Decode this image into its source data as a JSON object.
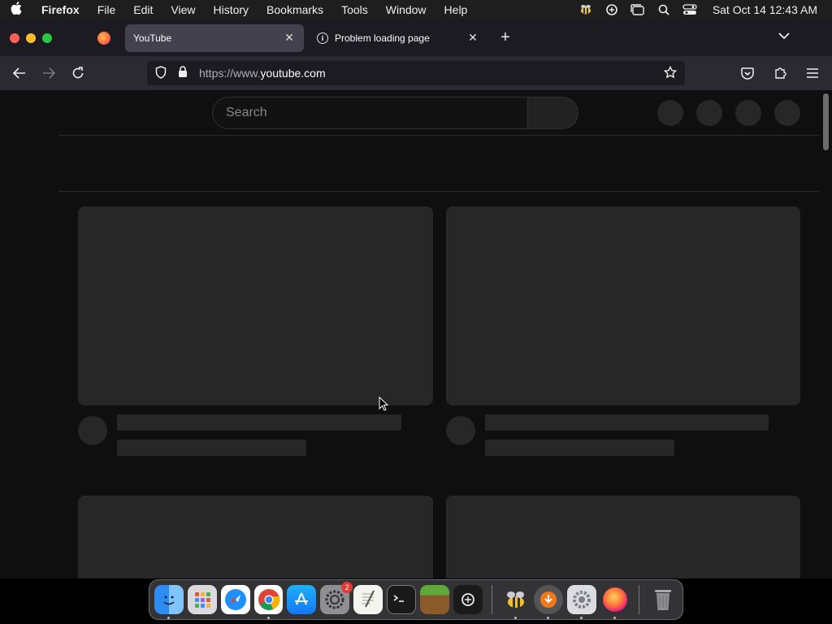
{
  "menubar": {
    "app_name": "Firefox",
    "items": [
      "File",
      "Edit",
      "View",
      "History",
      "Bookmarks",
      "Tools",
      "Window",
      "Help"
    ],
    "clock": "Sat Oct 14  12:43 AM"
  },
  "tabs": [
    {
      "label": "YouTube",
      "active": true
    },
    {
      "label": "Problem loading page",
      "active": false
    }
  ],
  "urlbar": {
    "prefix": "https://www.",
    "host": "youtube.com"
  },
  "youtube": {
    "search_placeholder": "Search"
  },
  "dock": {
    "settings_badge": "2"
  }
}
